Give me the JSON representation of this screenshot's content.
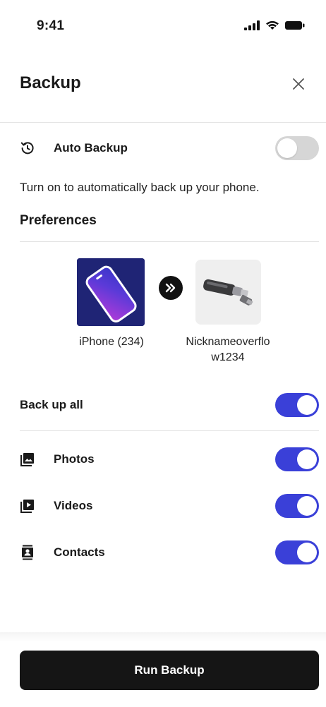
{
  "status_bar": {
    "time": "9:41",
    "icons": [
      "cellular-signal-icon",
      "wifi-icon",
      "battery-icon"
    ]
  },
  "header": {
    "title": "Backup",
    "close_icon": "close-icon"
  },
  "auto_backup": {
    "icon": "history-icon",
    "label": "Auto Backup",
    "enabled": false,
    "description": "Turn on to automatically back up your phone."
  },
  "preferences": {
    "title": "Preferences",
    "source_device": {
      "name": "iPhone (234)",
      "icon": "phone-icon"
    },
    "transfer_icon": "double-chevron-right-icon",
    "target_device": {
      "name": "Nicknameoverflow1234",
      "icon": "usb-drive-icon"
    }
  },
  "backup_all": {
    "label": "Back up all",
    "enabled": true
  },
  "items": [
    {
      "label": "Photos",
      "icon": "photos-icon",
      "enabled": true
    },
    {
      "label": "Videos",
      "icon": "videos-icon",
      "enabled": true
    },
    {
      "label": "Contacts",
      "icon": "contacts-icon",
      "enabled": true
    }
  ],
  "run_button": {
    "label": "Run Backup"
  },
  "colors": {
    "accent": "#3a40d8",
    "toggle_off": "#d6d6d6",
    "button_bg": "#151515",
    "device_tile": "#1f2475"
  }
}
